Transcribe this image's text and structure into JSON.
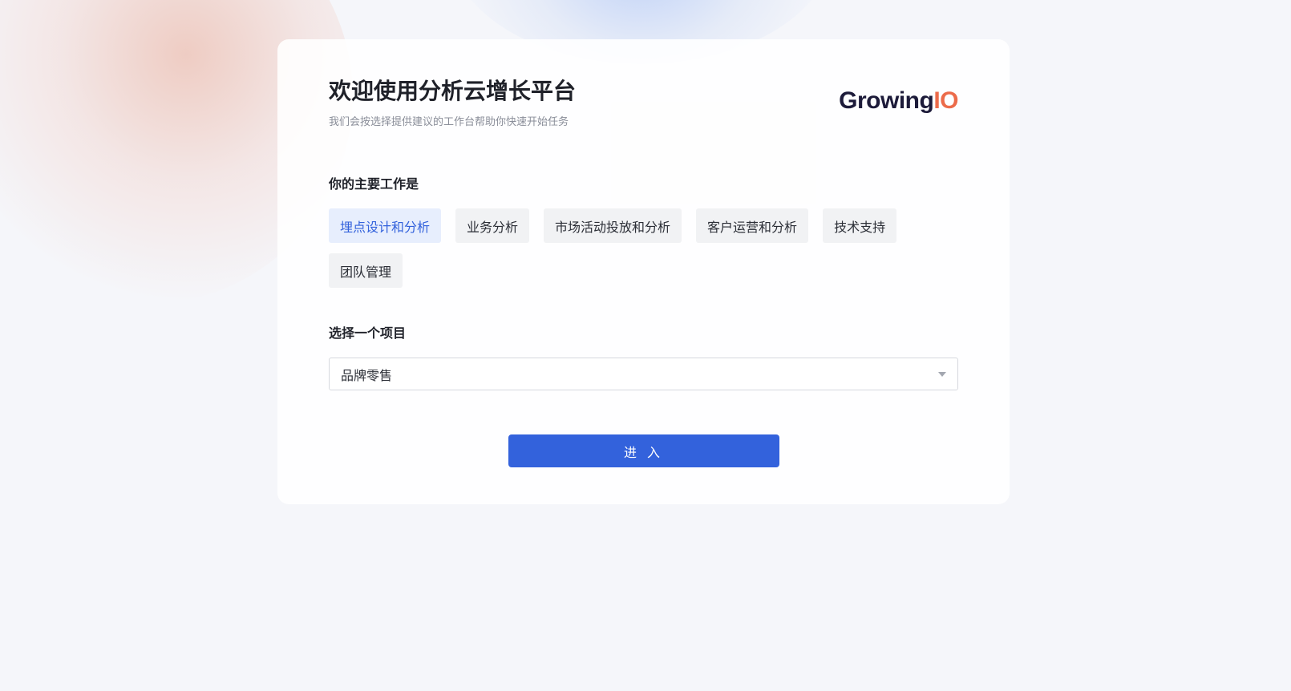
{
  "header": {
    "title": "欢迎使用分析云增长平台",
    "subtitle": "我们会按选择提供建议的工作台帮助你快速开始任务",
    "logo": {
      "main": "Growing",
      "accent": "IO",
      "main_color": "#1d1b3a",
      "accent_color": "#ec6b4a"
    }
  },
  "role_section": {
    "label": "你的主要工作是",
    "options": [
      {
        "label": "埋点设计和分析",
        "selected": true
      },
      {
        "label": "业务分析",
        "selected": false
      },
      {
        "label": "市场活动投放和分析",
        "selected": false
      },
      {
        "label": "客户运营和分析",
        "selected": false
      },
      {
        "label": "技术支持",
        "selected": false
      },
      {
        "label": "团队管理",
        "selected": false
      }
    ]
  },
  "project_section": {
    "label": "选择一个项目",
    "selected_value": "品牌零售",
    "dropdown_icon": "chevron-down-icon"
  },
  "enter_button": {
    "label": "进 入"
  },
  "colors": {
    "primary": "#3362dc",
    "selected_bg": "#e7eefd",
    "option_bg": "#f1f2f4",
    "page_bg": "#f5f6fa"
  }
}
